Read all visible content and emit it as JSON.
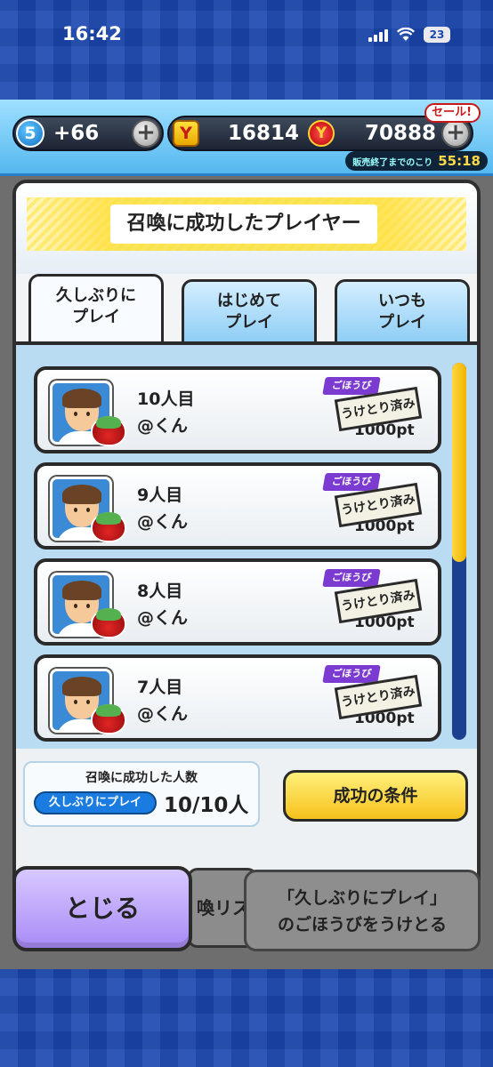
{
  "status_bar": {
    "time": "16:42",
    "battery": "23"
  },
  "currency": {
    "level": "5",
    "stamina": "+66",
    "coins": "16814",
    "money": "70888",
    "sale_badge": "セール!",
    "sale_label": "販売終了までのこり",
    "sale_timer": "55:18"
  },
  "panel": {
    "title": "召喚に成功したプレイヤー",
    "tabs": [
      {
        "label": "久しぶりに\nプレイ",
        "active": true
      },
      {
        "label": "はじめて\nプレイ",
        "active": false
      },
      {
        "label": "いつも\nプレイ",
        "active": false
      }
    ],
    "reward_badge": "ごほうび",
    "stamp_text": "うけとり済み",
    "entries": [
      {
        "count": "10人目",
        "name": "@くん",
        "reward": "1000pt"
      },
      {
        "count": "9人目",
        "name": "@くん",
        "reward": "1000pt"
      },
      {
        "count": "8人目",
        "name": "@くん",
        "reward": "1000pt"
      },
      {
        "count": "7人目",
        "name": "@くん",
        "reward": "1000pt"
      }
    ],
    "footer": {
      "count_label": "召喚に成功した人数",
      "count_chip": "久しぶりにプレイ",
      "count_value": "10/10人",
      "conditions_button": "成功の条件"
    }
  },
  "buttons": {
    "close": "とじる",
    "list_partial": "喚リス",
    "receive_line1": "「久しぶりにプレイ」",
    "receive_line2": "のごほうびをうけとる"
  }
}
